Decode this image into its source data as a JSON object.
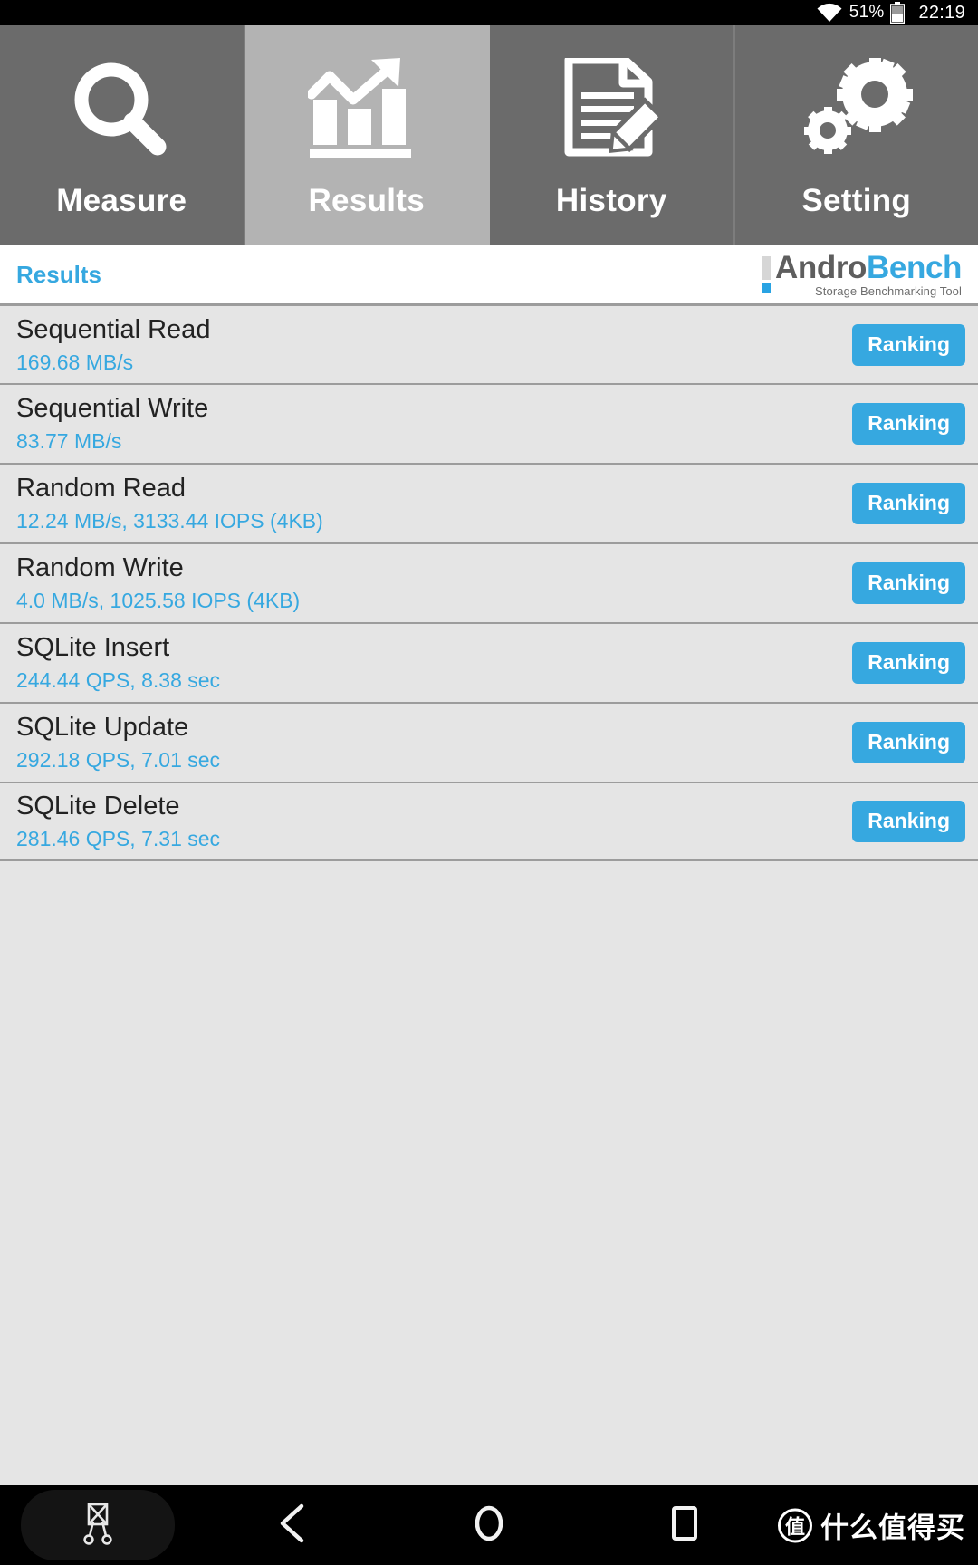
{
  "status_bar": {
    "wifi_icon": "wifi-icon",
    "battery_percent": "51%",
    "battery_icon": "battery-icon",
    "clock": "22:19"
  },
  "tabs": [
    {
      "label": "Measure",
      "icon": "magnifier-icon",
      "active": false
    },
    {
      "label": "Results",
      "icon": "bar-chart-arrow-icon",
      "active": true
    },
    {
      "label": "History",
      "icon": "document-pencil-icon",
      "active": false
    },
    {
      "label": "Setting",
      "icon": "gears-icon",
      "active": false
    }
  ],
  "header": {
    "page_title": "Results",
    "logo_word_1": "Andro",
    "logo_word_2": "Bench",
    "logo_tagline": "Storage Benchmarking Tool"
  },
  "colors": {
    "accent_blue": "#36a8e0",
    "tab_inactive": "#6b6b6b",
    "tab_active": "#b3b3b3",
    "row_bg": "#e5e5e5",
    "row_divider": "#9c9c9c"
  },
  "results": [
    {
      "name": "Sequential Read",
      "value": "169.68 MB/s",
      "button": "Ranking"
    },
    {
      "name": "Sequential Write",
      "value": "83.77 MB/s",
      "button": "Ranking"
    },
    {
      "name": "Random Read",
      "value": "12.24 MB/s, 3133.44 IOPS (4KB)",
      "button": "Ranking"
    },
    {
      "name": "Random Write",
      "value": "4.0 MB/s, 1025.58 IOPS (4KB)",
      "button": "Ranking"
    },
    {
      "name": "SQLite Insert",
      "value": "244.44 QPS, 8.38 sec",
      "button": "Ranking"
    },
    {
      "name": "SQLite Update",
      "value": "292.18 QPS, 7.01 sec",
      "button": "Ranking"
    },
    {
      "name": "SQLite Delete",
      "value": "281.46 QPS, 7.31 sec",
      "button": "Ranking"
    }
  ],
  "navbar": {
    "screenshot_icon": "screenshot-scissors-icon",
    "back_icon": "back-triangle-icon",
    "home_icon": "home-circle-icon",
    "recents_icon": "recents-square-icon",
    "watermark_badge": "值",
    "watermark_text": "什么值得买"
  }
}
